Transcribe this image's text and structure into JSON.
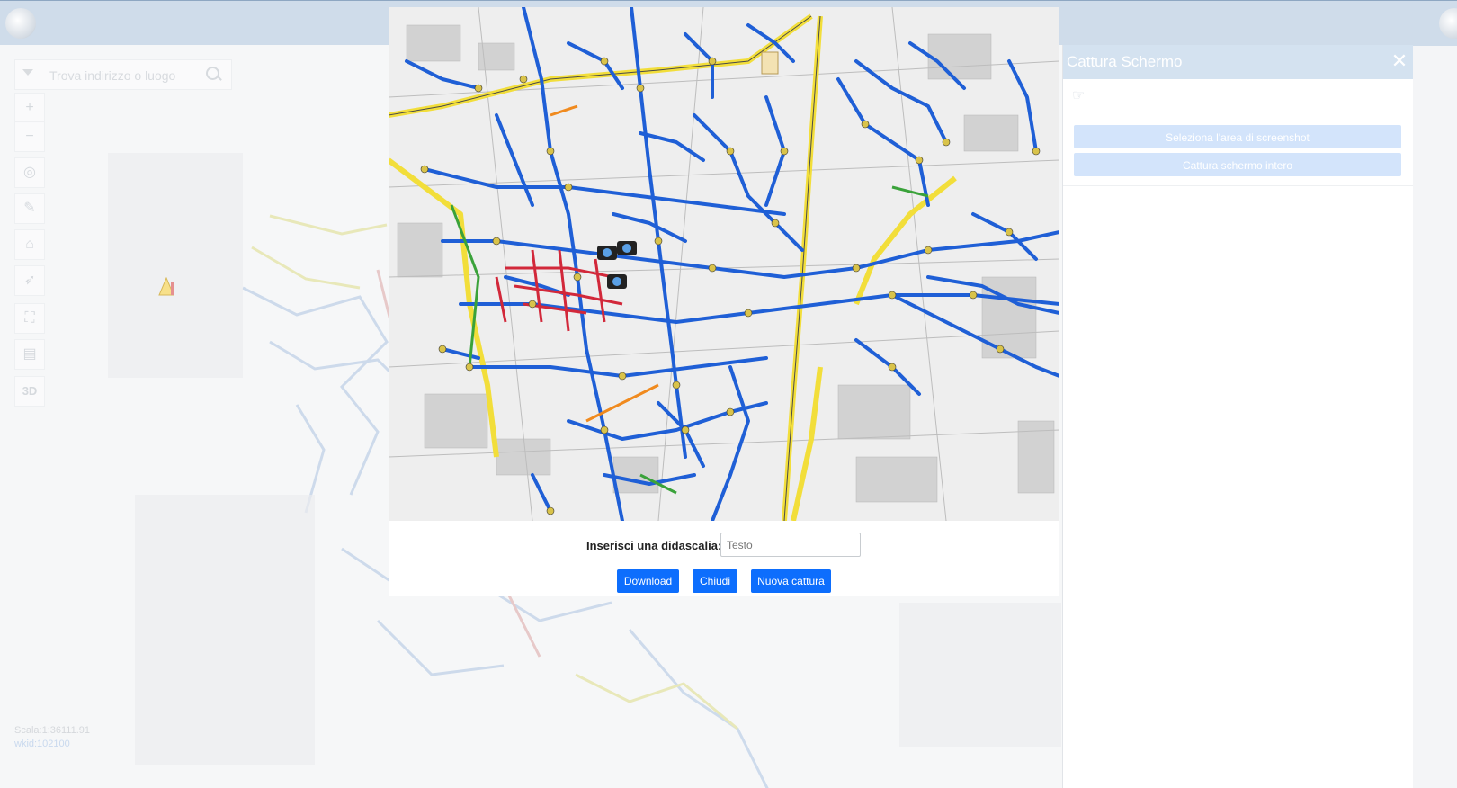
{
  "map": {
    "search_placeholder": "Trova indirizzo o luogo",
    "tools": [
      {
        "name": "zoom-in",
        "glyph": "+"
      },
      {
        "name": "zoom-out",
        "glyph": "−"
      },
      {
        "name": "locate",
        "glyph": "◎"
      },
      {
        "name": "measure",
        "glyph": "✎"
      },
      {
        "name": "home",
        "glyph": "⌂"
      },
      {
        "name": "compass",
        "glyph": "➶"
      },
      {
        "name": "fullscreen",
        "glyph": "⛶"
      },
      {
        "name": "basemap",
        "glyph": "▤"
      },
      {
        "name": "3d",
        "glyph": "3D"
      }
    ],
    "scale": "Scala:1:36111.91",
    "wkid": "wkid:102100"
  },
  "panel": {
    "title": "Cattura Schermo",
    "close_glyph": "✕",
    "pointer_icon": "☞",
    "btn_select_area": "Seleziona l'area di screenshot",
    "btn_full_screen": "Cattura schermo intero"
  },
  "modal": {
    "caption_label": "Inserisci una didascalia:",
    "caption_placeholder": "Testo",
    "btn_download": "Download",
    "btn_close": "Chiudi",
    "btn_new": "Nuova cattura"
  },
  "colors": {
    "accent": "#0d6efd",
    "network_blue": "#1f5fd6",
    "network_yellow": "#f2de3a",
    "network_red": "#d2283a",
    "network_green": "#3aa23a"
  }
}
